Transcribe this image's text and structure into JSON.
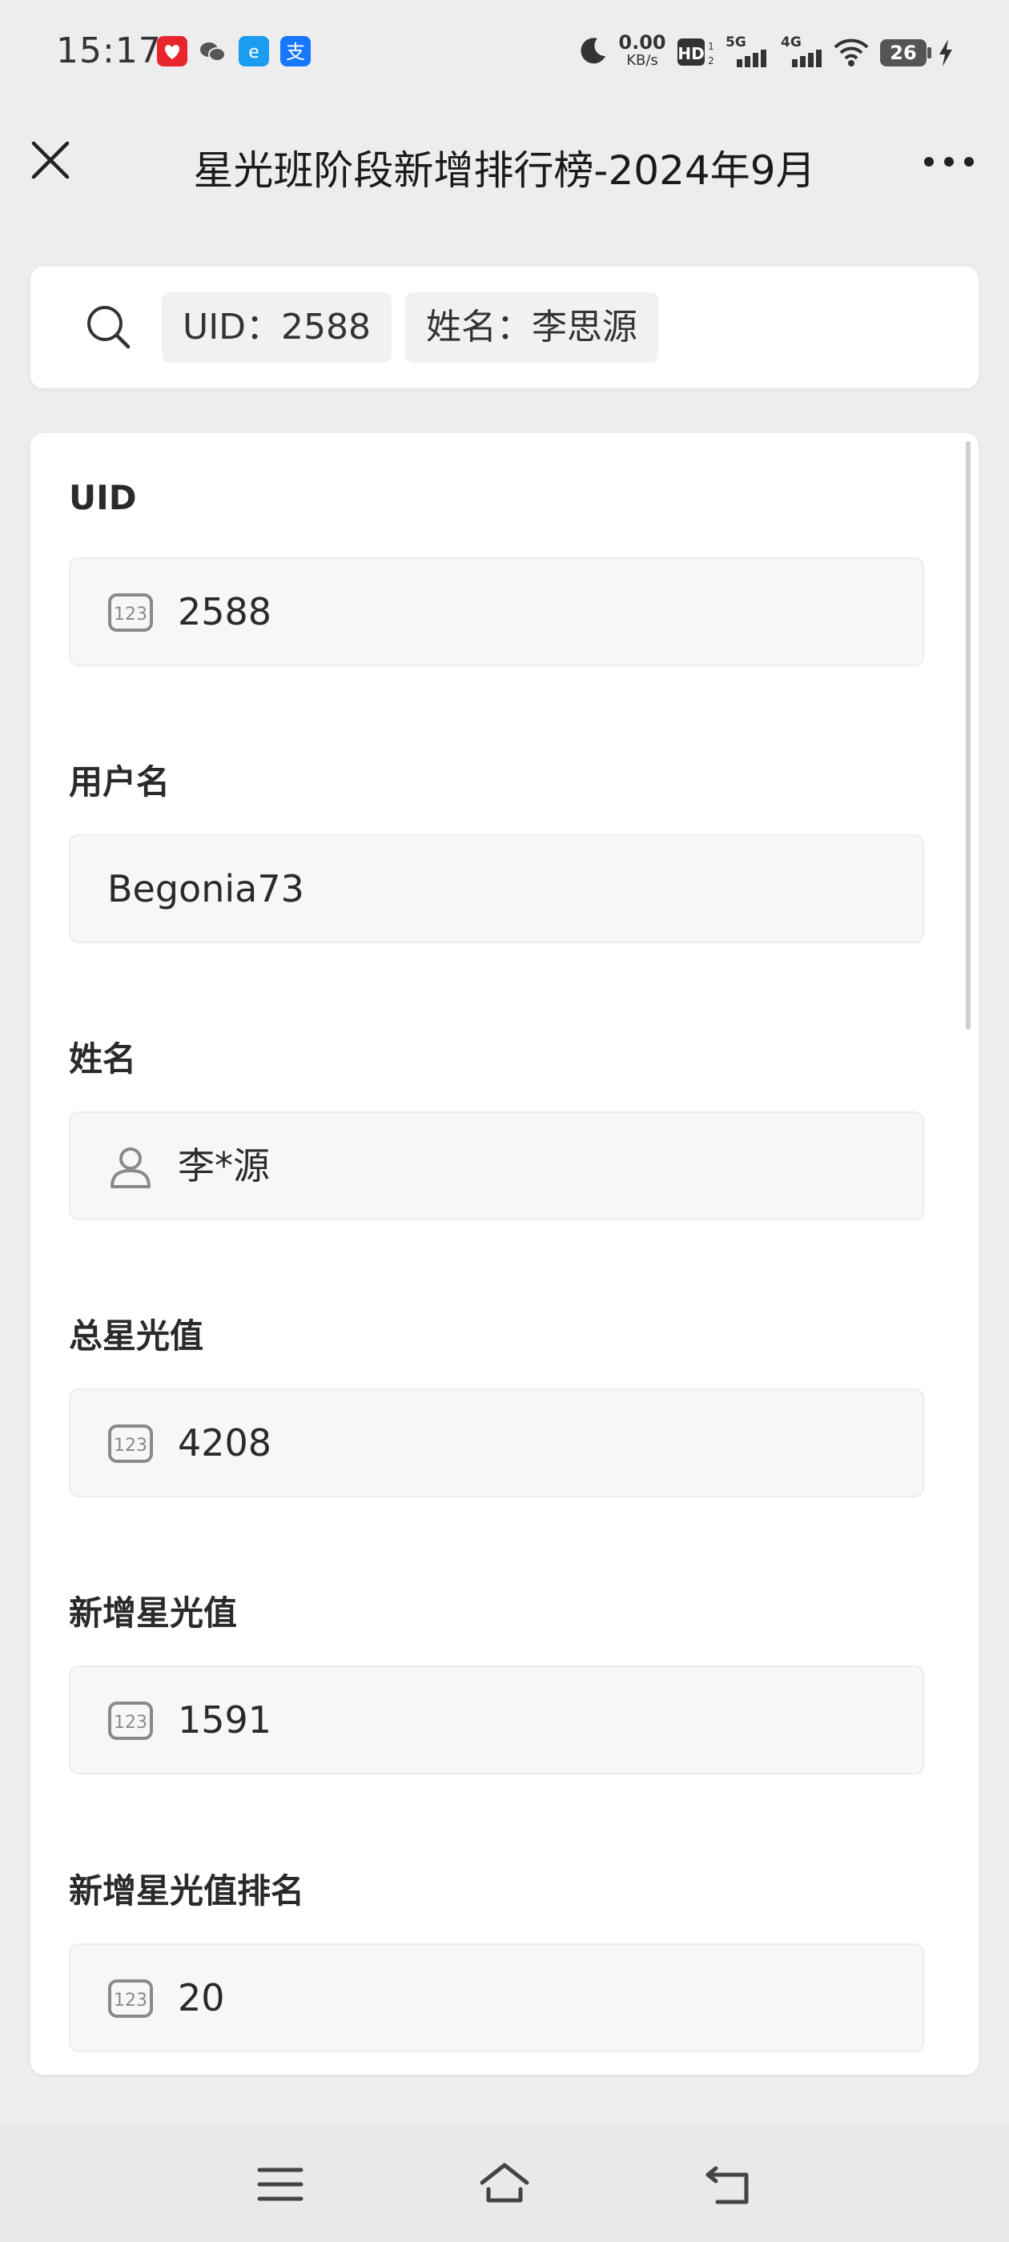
{
  "status_bar": {
    "time": "15:17",
    "network_speed_value": "0.00",
    "network_speed_unit": "KB/s",
    "battery_level": "26",
    "app_icons": [
      "notification-red-icon",
      "wechat-icon",
      "browser-icon",
      "alipay-icon"
    ],
    "colors": {
      "red_app": "#e8242c",
      "blue_app": "#1a9df0",
      "alipay": "#1677ff"
    }
  },
  "header": {
    "title": "星光班阶段新增排行榜-2024年9月"
  },
  "search": {
    "chips": [
      {
        "label": "UID：2588"
      },
      {
        "label": "姓名：李思源"
      }
    ]
  },
  "form": {
    "fields": [
      {
        "label": "UID",
        "value": "2588",
        "icon": "number-icon"
      },
      {
        "label": "用户名",
        "value": "Begonia73",
        "icon": ""
      },
      {
        "label": "姓名",
        "value": "李*源",
        "icon": "person-icon"
      },
      {
        "label": "总星光值",
        "value": "4208",
        "icon": "number-icon"
      },
      {
        "label": "新增星光值",
        "value": "1591",
        "icon": "number-icon"
      },
      {
        "label": "新增星光值排名",
        "value": "20",
        "icon": "number-icon"
      }
    ]
  }
}
